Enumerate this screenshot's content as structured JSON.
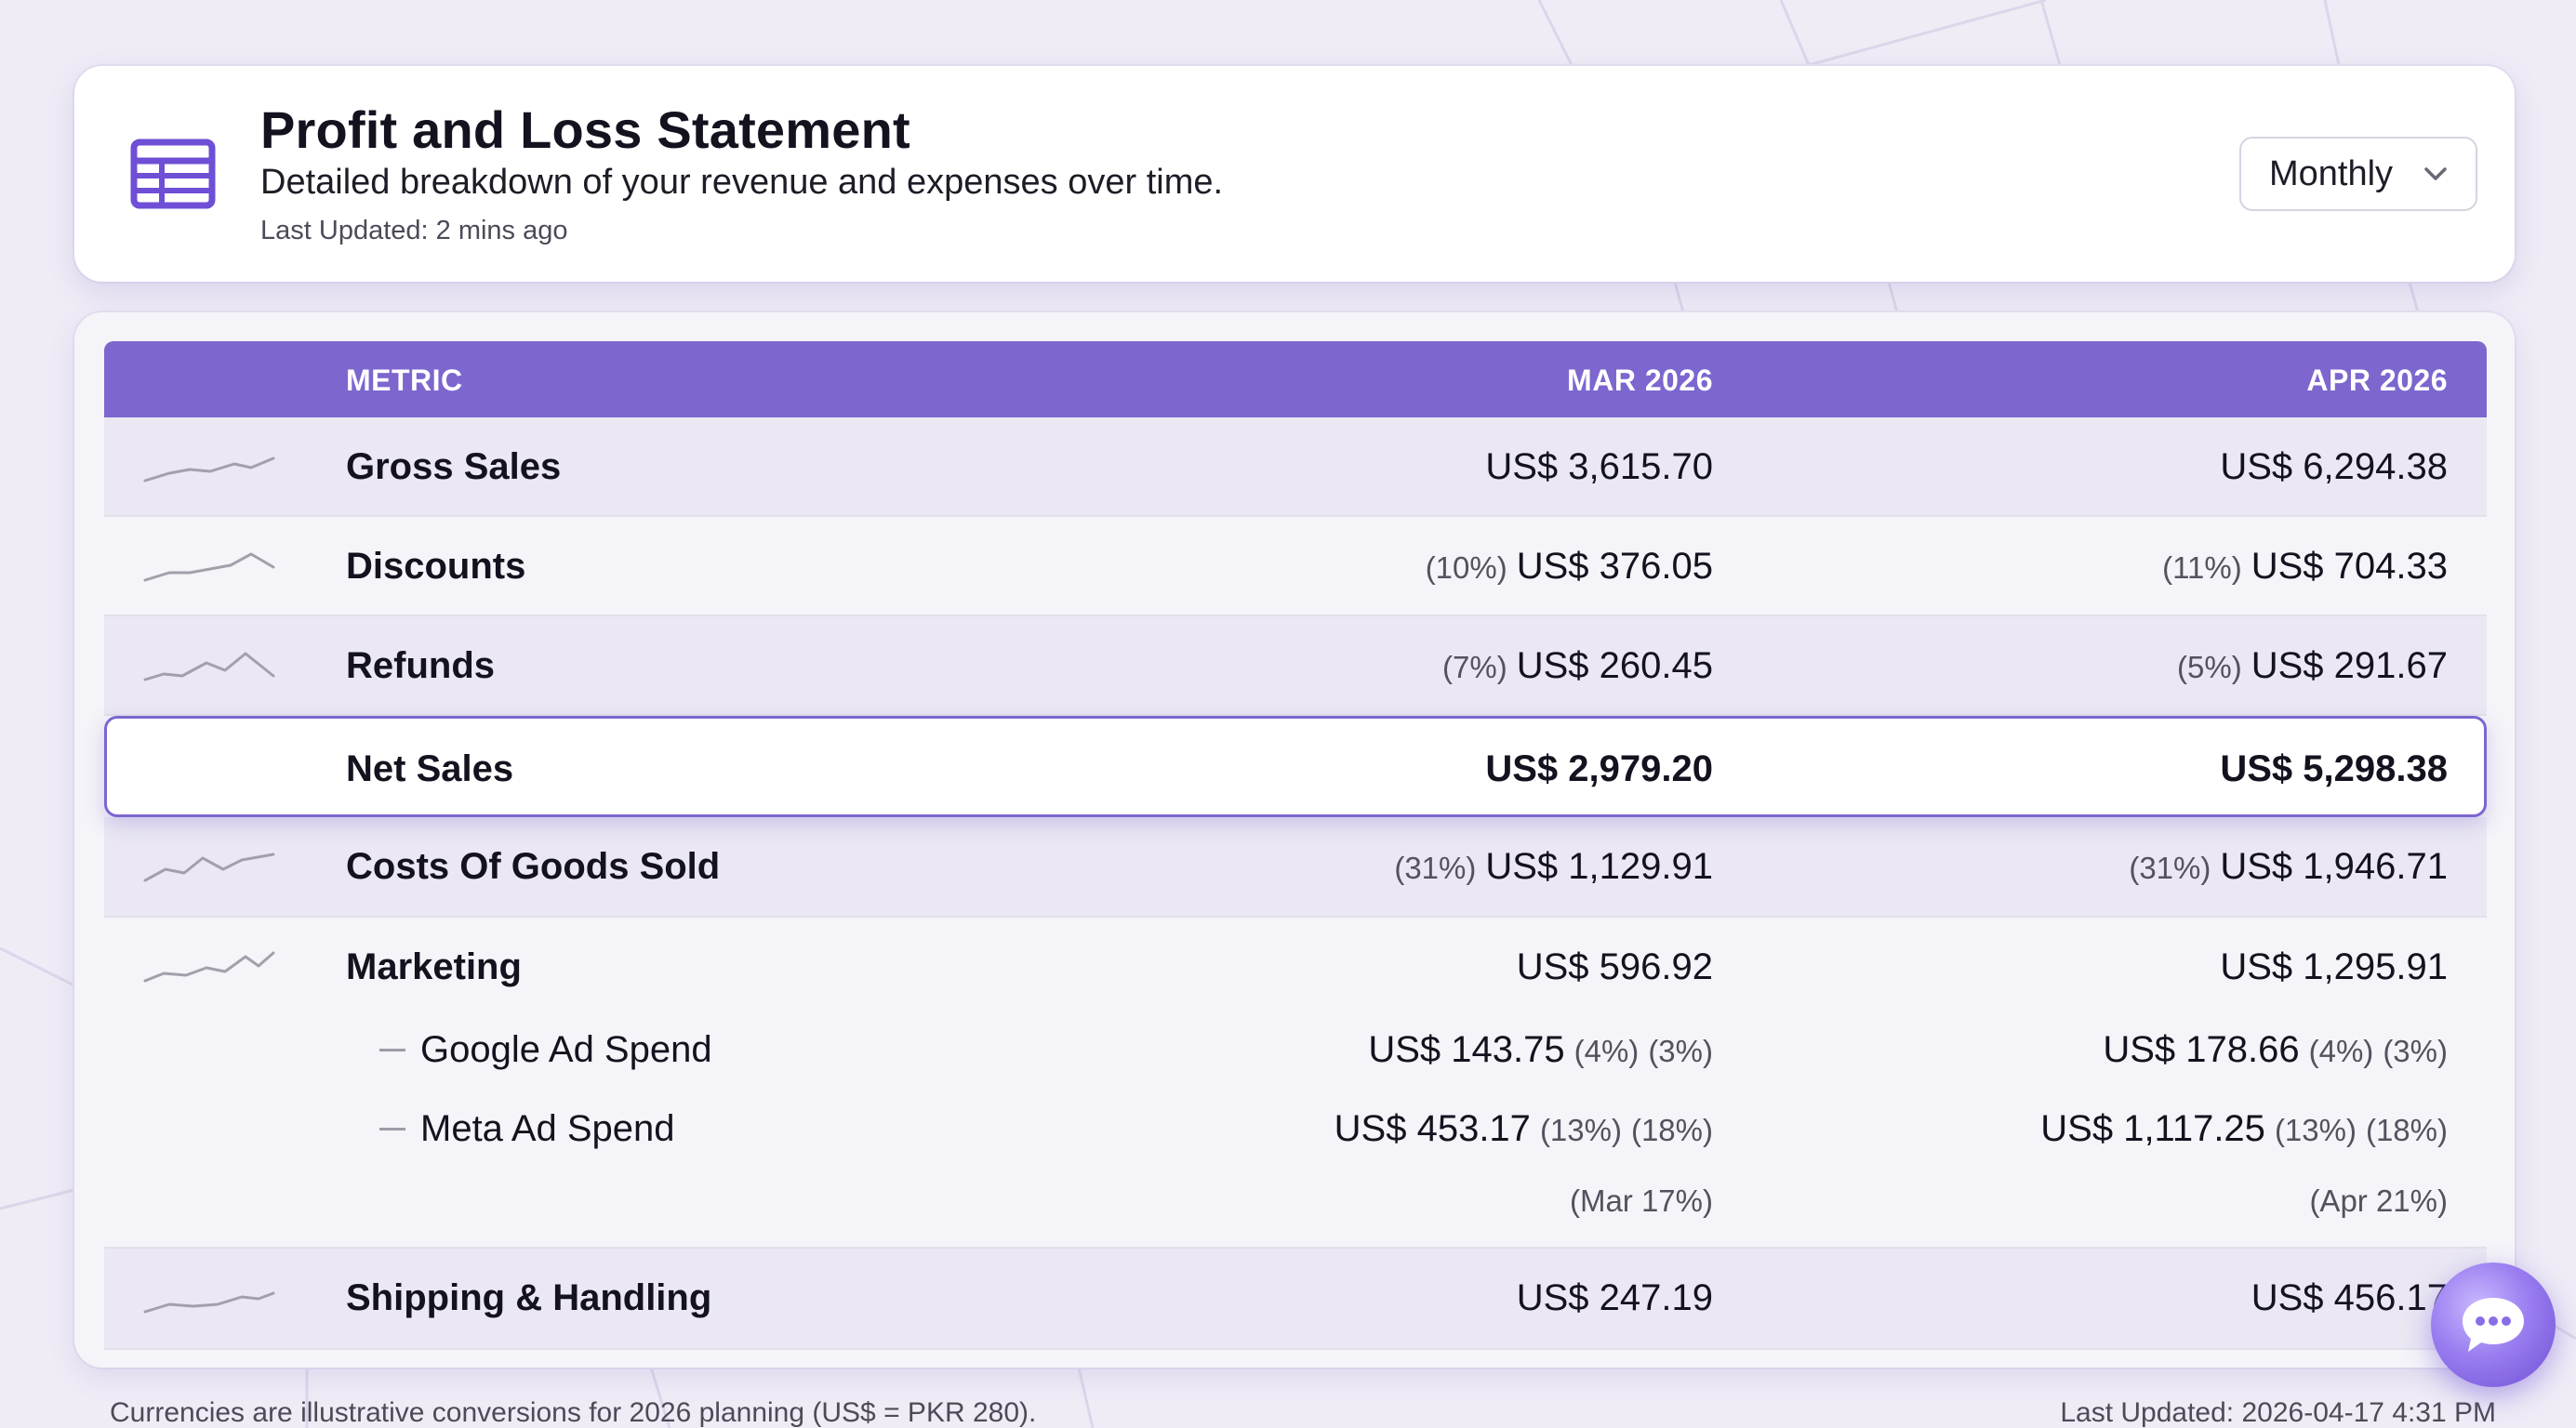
{
  "header": {
    "title": "Profit and Loss Statement",
    "subtitle": "Detailed breakdown of your revenue and expenses over time.",
    "last_updated": "Last Updated: 2 mins ago",
    "icon": "table-icon",
    "period_select": {
      "value": "Monthly",
      "icon": "chevron-down-icon"
    }
  },
  "table": {
    "columns": [
      "METRIC",
      "MAR 2026",
      "APR 2026"
    ],
    "rows": [
      {
        "label": "Gross Sales",
        "mar": {
          "pct": "",
          "value": "US$ 3,615.70"
        },
        "apr": {
          "pct": "",
          "value": "US$ 6,294.38"
        }
      },
      {
        "label": "Discounts",
        "mar": {
          "pct": "(10%)",
          "value": "US$ 376.05"
        },
        "apr": {
          "pct": "(11%)",
          "value": "US$ 704.33"
        }
      },
      {
        "label": "Refunds",
        "mar": {
          "pct": "(7%)",
          "value": "US$ 260.45"
        },
        "apr": {
          "pct": "(5%)",
          "value": "US$ 291.67"
        }
      },
      {
        "label": "Net Sales",
        "mar": {
          "pct": "",
          "value": "US$ 2,979.20"
        },
        "apr": {
          "pct": "",
          "value": "US$ 5,298.38"
        }
      },
      {
        "label": "Costs Of Goods Sold",
        "mar": {
          "pct": "(31%)",
          "value": "US$ 1,129.91"
        },
        "apr": {
          "pct": "(31%)",
          "value": "US$ 1,946.71"
        }
      },
      {
        "label": "Marketing",
        "mar": {
          "pct": "",
          "value": "US$ 596.92"
        },
        "apr": {
          "pct": "",
          "value": "US$ 1,295.91"
        }
      },
      {
        "label": "Shipping & Handling",
        "mar": {
          "pct": "",
          "value": "US$ 247.19"
        },
        "apr": {
          "pct": "",
          "value": "US$ 456.17"
        }
      }
    ],
    "marketing_breakdown": [
      {
        "label": "Google Ad Spend",
        "mar": {
          "value": "US$ 143.75",
          "pct1": "(4%)",
          "pct2": "(3%)"
        },
        "apr": {
          "value": "US$ 178.66",
          "pct1": "(4%)",
          "pct2": "(3%)"
        }
      },
      {
        "label": "Meta Ad Spend",
        "mar": {
          "value": "US$ 453.17",
          "pct1": "(13%)",
          "pct2": "(18%)"
        },
        "apr": {
          "value": "US$ 1,117.25",
          "pct1": "(13%)",
          "pct2": "(18%)"
        }
      }
    ],
    "marketing_notes": {
      "mar": "(Mar 17%)",
      "apr": "(Apr 21%)"
    }
  },
  "footer": {
    "left": "Currencies are illustrative conversions for 2026 planning (US$ = PKR 280).",
    "right": "Last Updated: 2026-04-17 4:31 PM"
  },
  "chat": {
    "icon": "chat-bubble-icon"
  },
  "colors": {
    "accent": "#7e66cf",
    "row_shade": "#ebe8f3",
    "background": "#efecf6"
  }
}
